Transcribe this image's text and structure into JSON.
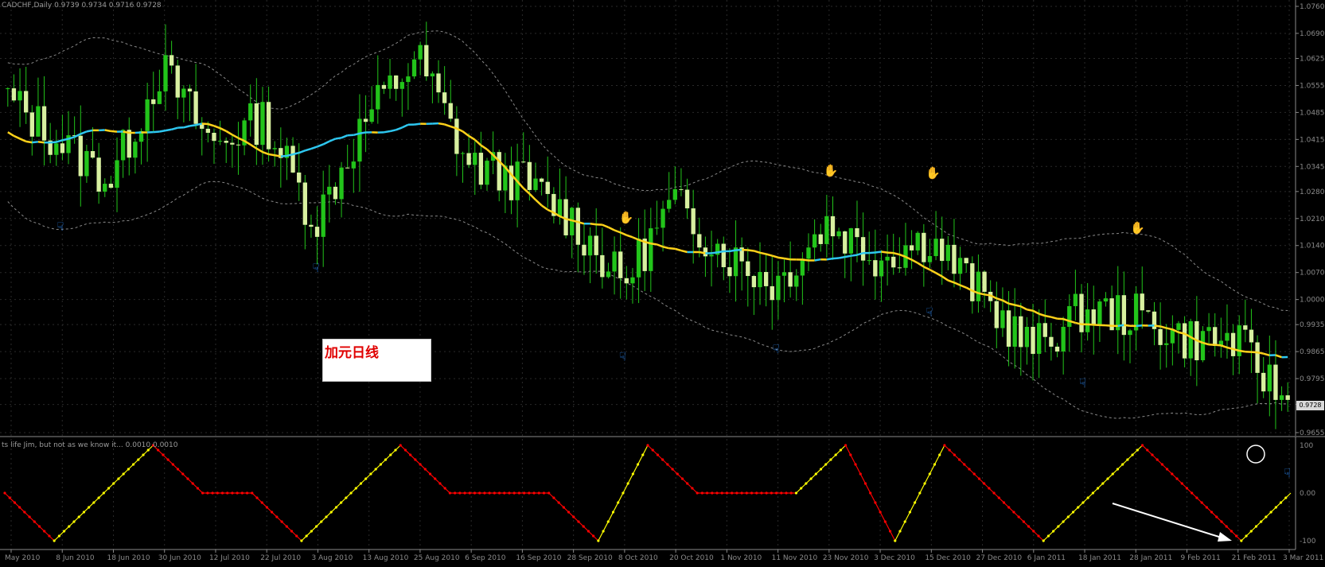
{
  "chart_title_info": "CADCHF,Daily 0.9739 0.9734 0.9716 0.9728",
  "annotation_label": "加元日线",
  "price_axis": {
    "labels": [
      "1.0760",
      "1.0690",
      "1.0625",
      "1.0555",
      "1.0485",
      "1.0415",
      "1.0345",
      "1.0280",
      "1.0210",
      "1.0140",
      "1.0070",
      "1.0000",
      "0.9935",
      "0.9865",
      "0.9795",
      "0.9728",
      "0.9655"
    ],
    "current_price_label": "0.9728"
  },
  "indicator": {
    "info_text": "ts life Jim, but not as we know it... 0.0010 0.0010",
    "axis_labels": [
      "100",
      "0.00",
      "-100"
    ]
  },
  "date_axis": {
    "labels": [
      "May 2010",
      "8 Jun 2010",
      "18 Jun 2010",
      "30 Jun 2010",
      "12 Jul 2010",
      "22 Jul 2010",
      "3 Aug 2010",
      "13 Aug 2010",
      "25 Aug 2010",
      "6 Sep 2010",
      "16 Sep 2010",
      "28 Sep 2010",
      "8 Oct 2010",
      "20 Oct 2010",
      "1 Nov 2010",
      "11 Nov 2010",
      "23 Nov 2010",
      "3 Dec 2010",
      "15 Dec 2010",
      "27 Dec 2010",
      "6 Jan 2011",
      "18 Jan 2011",
      "28 Jan 2011",
      "9 Feb 2011",
      "21 Feb 2011",
      "3 Mar 2011"
    ]
  },
  "chart_data": [
    {
      "type": "line",
      "title": "CADCHF,Daily",
      "ylim": [
        0.9655,
        1.076
      ],
      "x": [
        "May 2010",
        "8 Jun 2010",
        "18 Jun 2010",
        "30 Jun 2010",
        "12 Jul 2010",
        "22 Jul 2010",
        "3 Aug 2010",
        "13 Aug 2010",
        "25 Aug 2010",
        "6 Sep 2010",
        "16 Sep 2010",
        "28 Sep 2010",
        "8 Oct 2010",
        "20 Oct 2010",
        "1 Nov 2010",
        "11 Nov 2010",
        "23 Nov 2010",
        "3 Dec 2010",
        "15 Dec 2010",
        "27 Dec 2010",
        "6 Jan 2011",
        "18 Jan 2011",
        "28 Jan 2011",
        "9 Feb 2011",
        "21 Feb 2011",
        "3 Mar 2011"
      ],
      "series": [
        {
          "name": "close (approx)",
          "values": [
            1.052,
            1.041,
            1.031,
            1.06,
            1.04,
            1.047,
            1.02,
            1.047,
            1.063,
            1.035,
            1.031,
            1.021,
            1.004,
            1.025,
            1.012,
            1.004,
            1.02,
            1.011,
            1.016,
            1.001,
            0.987,
            0.997,
            0.996,
            0.99,
            0.989,
            0.9728
          ]
        }
      ],
      "ma_colors": {
        "rising": "#2ec7f0",
        "falling": "#ffd21a"
      },
      "band_color": "#8a8a8a",
      "candle_colors": {
        "up": "#22c41a",
        "down": "#d8f0a0"
      },
      "swing_high_markers": [
        "30 Jun 2010",
        "25 Aug 2010",
        "8 Oct 2010",
        "23 Nov 2010",
        "15 Dec 2010",
        "28 Jan 2011"
      ],
      "swing_low_markers": [
        "8 Jun 2010",
        "3 Aug 2010",
        "8 Oct 2010",
        "11 Nov 2010",
        "15 Dec 2010",
        "18 Jan 2011",
        "3 Mar 2011"
      ]
    },
    {
      "type": "line",
      "title": "",
      "ylim": [
        -100,
        100
      ],
      "series": [
        {
          "name": "oscillator",
          "values": [
            0,
            -100,
            0,
            100,
            0,
            0,
            -100,
            0,
            100,
            0,
            0,
            0,
            -100,
            100,
            0,
            0,
            0,
            100,
            -100,
            100,
            0,
            -100,
            0,
            100,
            0,
            -100,
            0
          ]
        }
      ],
      "colors": {
        "up": "#ffff00",
        "down": "#ff0000"
      }
    }
  ]
}
